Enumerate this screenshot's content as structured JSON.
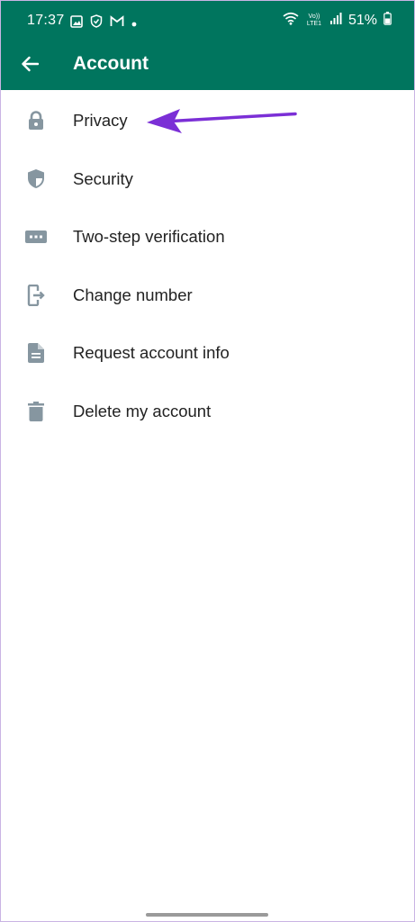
{
  "status_bar": {
    "time": "17:37",
    "network_label": "Vo)) LTE1",
    "battery": "51%"
  },
  "app_bar": {
    "title": "Account",
    "back_icon": "arrow-back-icon"
  },
  "menu": {
    "items": [
      {
        "label": "Privacy",
        "icon": "lock-icon"
      },
      {
        "label": "Security",
        "icon": "shield-icon"
      },
      {
        "label": "Two-step verification",
        "icon": "dots-keyboard-icon"
      },
      {
        "label": "Change number",
        "icon": "phone-exit-icon"
      },
      {
        "label": "Request account info",
        "icon": "document-icon"
      },
      {
        "label": "Delete my account",
        "icon": "trash-icon"
      }
    ]
  },
  "colors": {
    "header": "#00755e",
    "icon": "#8696a0",
    "annotation_arrow": "#7b2fd6"
  }
}
